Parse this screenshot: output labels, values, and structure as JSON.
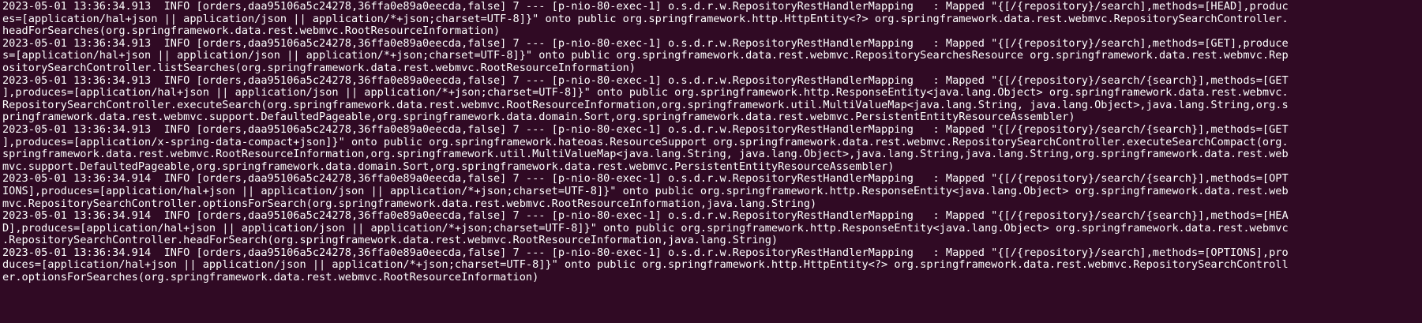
{
  "terminal": {
    "lines": [
      "2023-05-01 13:36:34.913  INFO [orders,daa95106a5c24278,36ffa0e89a0eecda,false] 7 --- [p-nio-80-exec-1] o.s.d.r.w.RepositoryRestHandlerMapping   : Mapped \"{[/{repository}/search],methods=[HEAD],produc",
      "es=[application/hal+json || application/json || application/*+json;charset=UTF-8]}\" onto public org.springframework.http.HttpEntity<?> org.springframework.data.rest.webmvc.RepositorySearchController.",
      "headForSearches(org.springframework.data.rest.webmvc.RootResourceInformation)",
      "2023-05-01 13:36:34.913  INFO [orders,daa95106a5c24278,36ffa0e89a0eecda,false] 7 --- [p-nio-80-exec-1] o.s.d.r.w.RepositoryRestHandlerMapping   : Mapped \"{[/{repository}/search],methods=[GET],produce",
      "s=[application/hal+json || application/json || application/*+json;charset=UTF-8]}\" onto public org.springframework.data.rest.webmvc.RepositorySearchesResource org.springframework.data.rest.webmvc.Rep",
      "ositorySearchController.listSearches(org.springframework.data.rest.webmvc.RootResourceInformation)",
      "2023-05-01 13:36:34.913  INFO [orders,daa95106a5c24278,36ffa0e89a0eecda,false] 7 --- [p-nio-80-exec-1] o.s.d.r.w.RepositoryRestHandlerMapping   : Mapped \"{[/{repository}/search/{search}],methods=[GET",
      "],produces=[application/hal+json || application/json || application/*+json;charset=UTF-8]}\" onto public org.springframework.http.ResponseEntity<java.lang.Object> org.springframework.data.rest.webmvc.",
      "RepositorySearchController.executeSearch(org.springframework.data.rest.webmvc.RootResourceInformation,org.springframework.util.MultiValueMap<java.lang.String, java.lang.Object>,java.lang.String,org.s",
      "pringframework.data.rest.webmvc.support.DefaultedPageable,org.springframework.data.domain.Sort,org.springframework.data.rest.webmvc.PersistentEntityResourceAssembler)",
      "2023-05-01 13:36:34.913  INFO [orders,daa95106a5c24278,36ffa0e89a0eecda,false] 7 --- [p-nio-80-exec-1] o.s.d.r.w.RepositoryRestHandlerMapping   : Mapped \"{[/{repository}/search/{search}],methods=[GET",
      "],produces=[application/x-spring-data-compact+json]}\" onto public org.springframework.hateoas.ResourceSupport org.springframework.data.rest.webmvc.RepositorySearchController.executeSearchCompact(org.",
      "springframework.data.rest.webmvc.RootResourceInformation,org.springframework.util.MultiValueMap<java.lang.String, java.lang.Object>,java.lang.String,java.lang.String,org.springframework.data.rest.web",
      "mvc.support.DefaultedPageable,org.springframework.data.domain.Sort,org.springframework.data.rest.webmvc.PersistentEntityResourceAssembler)",
      "2023-05-01 13:36:34.914  INFO [orders,daa95106a5c24278,36ffa0e89a0eecda,false] 7 --- [p-nio-80-exec-1] o.s.d.r.w.RepositoryRestHandlerMapping   : Mapped \"{[/{repository}/search/{search}],methods=[OPT",
      "IONS],produces=[application/hal+json || application/json || application/*+json;charset=UTF-8]}\" onto public org.springframework.http.ResponseEntity<java.lang.Object> org.springframework.data.rest.web",
      "mvc.RepositorySearchController.optionsForSearch(org.springframework.data.rest.webmvc.RootResourceInformation,java.lang.String)",
      "2023-05-01 13:36:34.914  INFO [orders,daa95106a5c24278,36ffa0e89a0eecda,false] 7 --- [p-nio-80-exec-1] o.s.d.r.w.RepositoryRestHandlerMapping   : Mapped \"{[/{repository}/search/{search}],methods=[HEA",
      "D],produces=[application/hal+json || application/json || application/*+json;charset=UTF-8]}\" onto public org.springframework.http.ResponseEntity<java.lang.Object> org.springframework.data.rest.webmvc",
      ".RepositorySearchController.headForSearch(org.springframework.data.rest.webmvc.RootResourceInformation,java.lang.String)",
      "2023-05-01 13:36:34.914  INFO [orders,daa95106a5c24278,36ffa0e89a0eecda,false] 7 --- [p-nio-80-exec-1] o.s.d.r.w.RepositoryRestHandlerMapping   : Mapped \"{[/{repository}/search],methods=[OPTIONS],pro",
      "duces=[application/hal+json || application/json || application/*+json;charset=UTF-8]}\" onto public org.springframework.http.HttpEntity<?> org.springframework.data.rest.webmvc.RepositorySearchControll",
      "er.optionsForSearches(org.springframework.data.rest.webmvc.RootResourceInformation)"
    ]
  },
  "colors": {
    "background": "#300a24",
    "text": "#ffffff"
  }
}
